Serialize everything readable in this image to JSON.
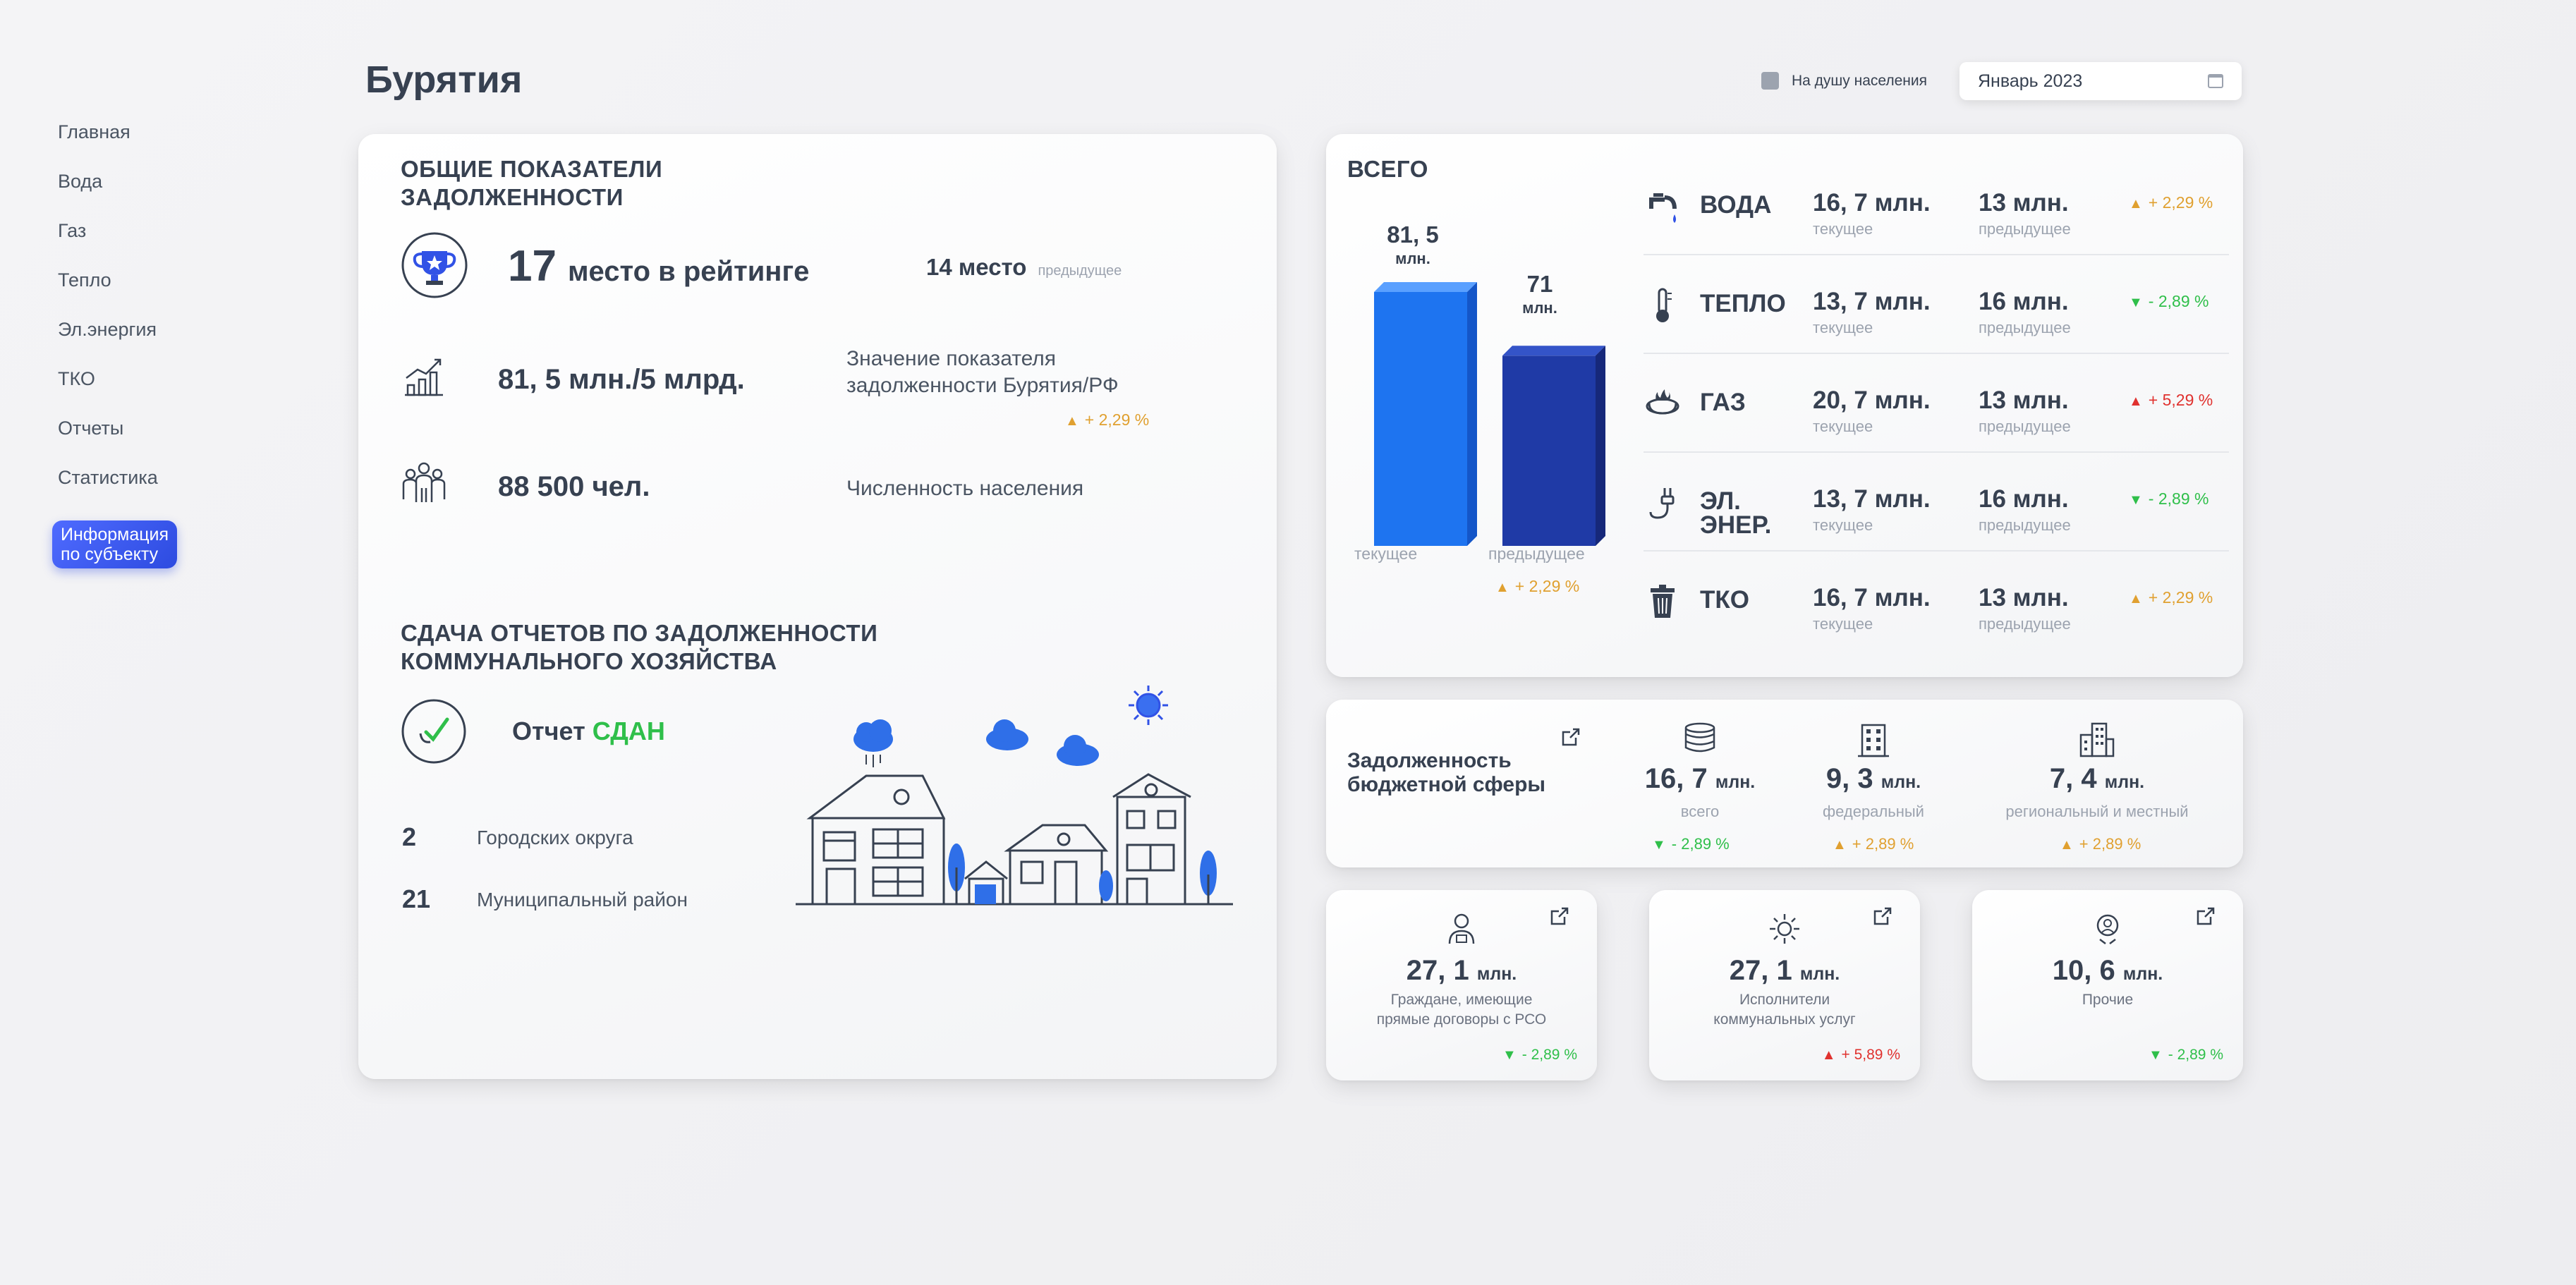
{
  "sidebar": {
    "items": [
      "Главная",
      "Вода",
      "Газ",
      "Тепло",
      "Эл.энергия",
      "ТКО",
      "Отчеты",
      "Статистика"
    ],
    "active": "Информация\nпо субъекту"
  },
  "header": {
    "title": "Бурятия",
    "toggle_label": "На душу населения",
    "date": "Январь 2023"
  },
  "general": {
    "title": "ОБЩИЕ ПОКАЗАТЕЛИ\nЗАДОЛЖЕННОСТИ",
    "rank_num": "17",
    "rank_text": "место в рейтинге",
    "prev_rank": "14 место",
    "prev_label": "предыдущее",
    "ratio_value": "81, 5 млн./5 млрд.",
    "ratio_desc": "Значение показателя\nзадолженности Бурятия/РФ",
    "ratio_change": "+ 2,29 %",
    "population_value": "88 500 чел.",
    "population_desc": "Численность населения"
  },
  "reports": {
    "title": "СДАЧА ОТЧЕТОВ ПО ЗАДОЛЖЕННОСТИ\nКОММУНАЛЬНОГО ХОЗЯЙСТВА",
    "status_prefix": "Отчет",
    "status": "СДАН",
    "districts_count": "2",
    "districts_label": "Городских округа",
    "municipal_count": "21",
    "municipal_label": "Муниципальный район"
  },
  "total": {
    "title": "ВСЕГО",
    "current_value": "81, 5",
    "previous_value": "71",
    "unit": "млн.",
    "current_label": "текущее",
    "previous_label": "предыдущее",
    "change": "+ 2,29 %"
  },
  "chart_data": {
    "type": "bar",
    "categories": [
      "текущее",
      "предыдущее"
    ],
    "values": [
      81.5,
      71
    ],
    "ylabel": "млн."
  },
  "utilities": [
    {
      "name": "ВОДА",
      "current": "16, 7 млн.",
      "current_label": "текущее",
      "previous": "13 млн.",
      "previous_label": "предыдущее",
      "change": "+ 2,29 %",
      "dir": "up-orange"
    },
    {
      "name": "ТЕПЛО",
      "current": "13, 7 млн.",
      "current_label": "текущее",
      "previous": "16 млн.",
      "previous_label": "предыдущее",
      "change": "- 2,89 %",
      "dir": "down-green"
    },
    {
      "name": "ГАЗ",
      "current": "20, 7 млн.",
      "current_label": "текущее",
      "previous": "13 млн.",
      "previous_label": "предыдущее",
      "change": "+ 5,29 %",
      "dir": "up-red"
    },
    {
      "name": "ЭЛ.\nЭНЕР.",
      "current": "13, 7 млн.",
      "current_label": "текущее",
      "previous": "16 млн.",
      "previous_label": "предыдущее",
      "change": "- 2,89 %",
      "dir": "down-green"
    },
    {
      "name": "ТКО",
      "current": "16, 7 млн.",
      "current_label": "текущее",
      "previous": "13 млн.",
      "previous_label": "предыдущее",
      "change": "+ 2,29 %",
      "dir": "up-orange"
    }
  ],
  "budget": {
    "title": "Задолженность\nбюджетной сферы",
    "total_value": "16, 7",
    "total_unit": "млн.",
    "total_label": "всего",
    "total_change": "- 2,89 %",
    "federal_value": "9, 3",
    "federal_unit": "млн.",
    "federal_label": "федеральный",
    "federal_change": "+ 2,89 %",
    "regional_value": "7, 4",
    "regional_unit": "млн.",
    "regional_label": "региональный и местный",
    "regional_change": "+ 2,89 %"
  },
  "categories": [
    {
      "value": "27, 1",
      "unit": "млн.",
      "label": "Граждане, имеющие\nпрямые договоры с РСО",
      "change": "- 2,89 %",
      "dir": "down-green"
    },
    {
      "value": "27, 1",
      "unit": "млн.",
      "label": "Исполнители\nкоммунальных услуг",
      "change": "+ 5,89 %",
      "dir": "up-red"
    },
    {
      "value": "10, 6",
      "unit": "млн.",
      "label": "Прочие",
      "change": "- 2,89 %",
      "dir": "down-green"
    }
  ],
  "colors": {
    "accent": "#2d4be0",
    "bar_current": "#1e74f0",
    "bar_previous": "#1f3aa6",
    "status_ok": "#2fbf4a",
    "up_orange": "#e0a030",
    "up_red": "#e0322f"
  }
}
